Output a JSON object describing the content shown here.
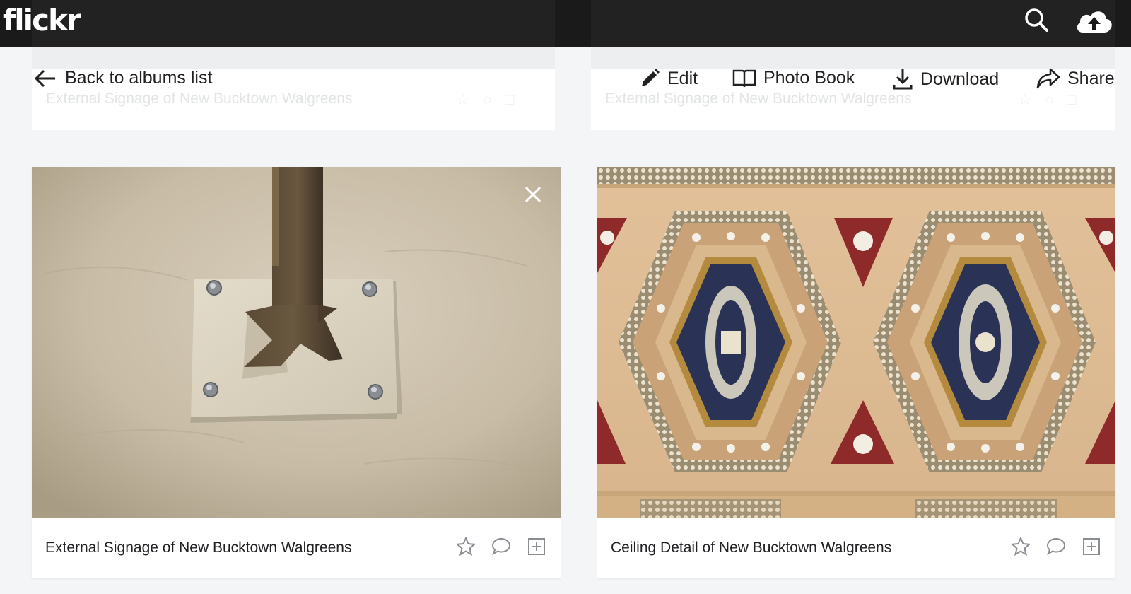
{
  "header": {
    "logo": "flickr"
  },
  "album_bar": {
    "back_label": "Back to albums list",
    "actions": [
      {
        "label": "Edit",
        "icon": "pencil-icon"
      },
      {
        "label": "Photo Book",
        "icon": "book-icon"
      },
      {
        "label": "Download",
        "icon": "download-icon"
      },
      {
        "label": "Share",
        "icon": "share-icon"
      }
    ]
  },
  "previous_row": {
    "titles": [
      "External Signage of New Bucktown Walgreens",
      "External Signage of New Bucktown Walgreens"
    ]
  },
  "photos": [
    {
      "title": "External Signage of New Bucktown Walgreens",
      "selected": true
    },
    {
      "title": "Ceiling Detail of New Bucktown Walgreens",
      "selected": false
    }
  ],
  "colors": {
    "topbar": "#1a1a1a",
    "page_background": "#f3f5f6",
    "text": "#212124"
  }
}
